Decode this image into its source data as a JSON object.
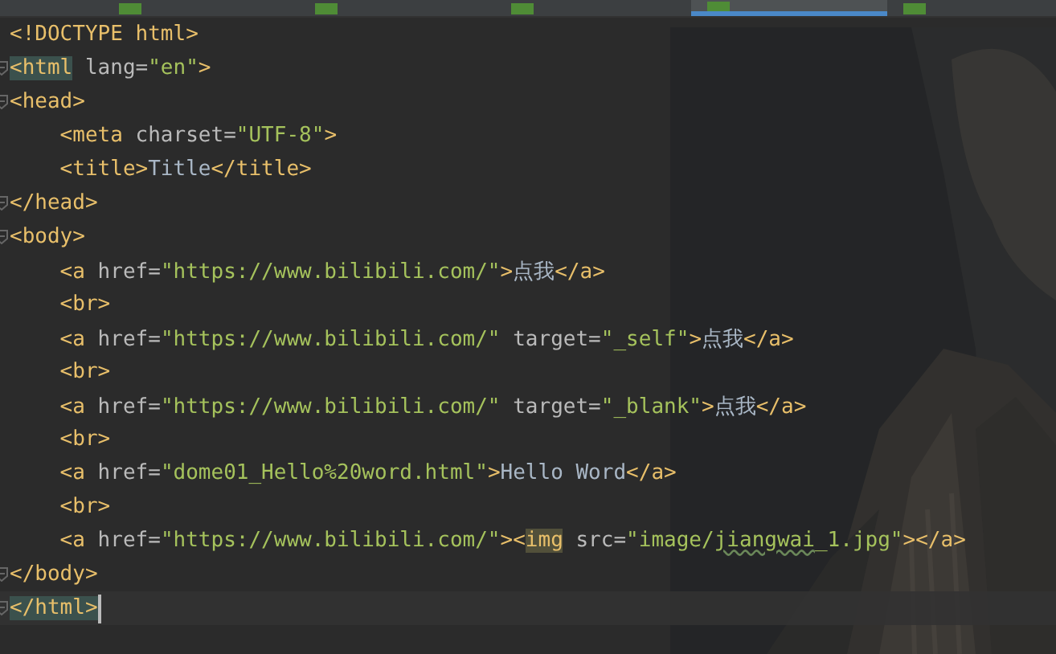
{
  "tabs": [
    {
      "selected": false,
      "icon": true
    },
    {
      "selected": false,
      "icon": true
    },
    {
      "selected": false,
      "icon": true
    },
    {
      "selected": true,
      "icon": true
    },
    {
      "selected": false,
      "icon": true
    }
  ],
  "lines": [
    {
      "fold": false,
      "current": false,
      "tokens": [
        {
          "kind": "tag",
          "text": "<!DOCTYPE html>"
        }
      ]
    },
    {
      "fold": true,
      "current": false,
      "tokens": [
        {
          "kind": "match",
          "text": "<html"
        },
        {
          "kind": "attr",
          "text": " lang="
        },
        {
          "kind": "value",
          "text": "\"en\""
        },
        {
          "kind": "tag",
          "text": ">"
        }
      ]
    },
    {
      "fold": true,
      "current": false,
      "tokens": [
        {
          "kind": "tag",
          "text": "<head>"
        }
      ]
    },
    {
      "fold": false,
      "current": false,
      "tokens": [
        {
          "kind": "tag",
          "text": "    <meta"
        },
        {
          "kind": "attr",
          "text": " charset="
        },
        {
          "kind": "value",
          "text": "\"UTF-8\""
        },
        {
          "kind": "tag",
          "text": ">"
        }
      ]
    },
    {
      "fold": false,
      "current": false,
      "tokens": [
        {
          "kind": "tag",
          "text": "    <title>"
        },
        {
          "kind": "text",
          "text": "Title"
        },
        {
          "kind": "tag",
          "text": "</title>"
        }
      ]
    },
    {
      "fold": true,
      "current": false,
      "tokens": [
        {
          "kind": "tag",
          "text": "</head>"
        }
      ]
    },
    {
      "fold": true,
      "current": false,
      "tokens": [
        {
          "kind": "tag",
          "text": "<body>"
        }
      ]
    },
    {
      "fold": false,
      "current": false,
      "tokens": [
        {
          "kind": "tag",
          "text": "    <a"
        },
        {
          "kind": "attr",
          "text": " href="
        },
        {
          "kind": "value",
          "text": "\"https://www.bilibili.com/\""
        },
        {
          "kind": "tag",
          "text": ">"
        },
        {
          "kind": "text",
          "text": "点我"
        },
        {
          "kind": "tag",
          "text": "</a>"
        }
      ]
    },
    {
      "fold": false,
      "current": false,
      "tokens": [
        {
          "kind": "tag",
          "text": "    <br>"
        }
      ]
    },
    {
      "fold": false,
      "current": false,
      "tokens": [
        {
          "kind": "tag",
          "text": "    <a"
        },
        {
          "kind": "attr",
          "text": " href="
        },
        {
          "kind": "value",
          "text": "\"https://www.bilibili.com/\""
        },
        {
          "kind": "attr",
          "text": " target="
        },
        {
          "kind": "value",
          "text": "\"_self\""
        },
        {
          "kind": "tag",
          "text": ">"
        },
        {
          "kind": "text",
          "text": "点我"
        },
        {
          "kind": "tag",
          "text": "</a>"
        }
      ]
    },
    {
      "fold": false,
      "current": false,
      "tokens": [
        {
          "kind": "tag",
          "text": "    <br>"
        }
      ]
    },
    {
      "fold": false,
      "current": false,
      "tokens": [
        {
          "kind": "tag",
          "text": "    <a"
        },
        {
          "kind": "attr",
          "text": " href="
        },
        {
          "kind": "value",
          "text": "\"https://www.bilibili.com/\""
        },
        {
          "kind": "attr",
          "text": " target="
        },
        {
          "kind": "value",
          "text": "\"_blank\""
        },
        {
          "kind": "tag",
          "text": ">"
        },
        {
          "kind": "text",
          "text": "点我"
        },
        {
          "kind": "tag",
          "text": "</a>"
        }
      ]
    },
    {
      "fold": false,
      "current": false,
      "tokens": [
        {
          "kind": "tag",
          "text": "    <br>"
        }
      ]
    },
    {
      "fold": false,
      "current": false,
      "tokens": [
        {
          "kind": "tag",
          "text": "    <a"
        },
        {
          "kind": "attr",
          "text": " href="
        },
        {
          "kind": "value",
          "text": "\"dome01_Hello%20word.html\""
        },
        {
          "kind": "tag",
          "text": ">"
        },
        {
          "kind": "text",
          "text": "Hello Word"
        },
        {
          "kind": "tag",
          "text": "</a>"
        }
      ]
    },
    {
      "fold": false,
      "current": false,
      "tokens": [
        {
          "kind": "tag",
          "text": "    <br>"
        }
      ]
    },
    {
      "fold": false,
      "current": false,
      "tokens": [
        {
          "kind": "tag",
          "text": "    <a"
        },
        {
          "kind": "attr",
          "text": " href="
        },
        {
          "kind": "value",
          "text": "\"https://www.bilibili.com/\""
        },
        {
          "kind": "tag",
          "text": "><"
        },
        {
          "kind": "ref",
          "text": "img"
        },
        {
          "kind": "attr",
          "text": " src="
        },
        {
          "kind": "value",
          "text": "\"image/"
        },
        {
          "kind": "typo",
          "text": "jiangwai"
        },
        {
          "kind": "value",
          "text": "_1.jpg\""
        },
        {
          "kind": "tag",
          "text": "></a>"
        }
      ]
    },
    {
      "fold": true,
      "current": false,
      "tokens": [
        {
          "kind": "tag",
          "text": "</body>"
        }
      ]
    },
    {
      "fold": true,
      "current": true,
      "tokens": [
        {
          "kind": "match",
          "text": "</html>"
        }
      ]
    }
  ]
}
